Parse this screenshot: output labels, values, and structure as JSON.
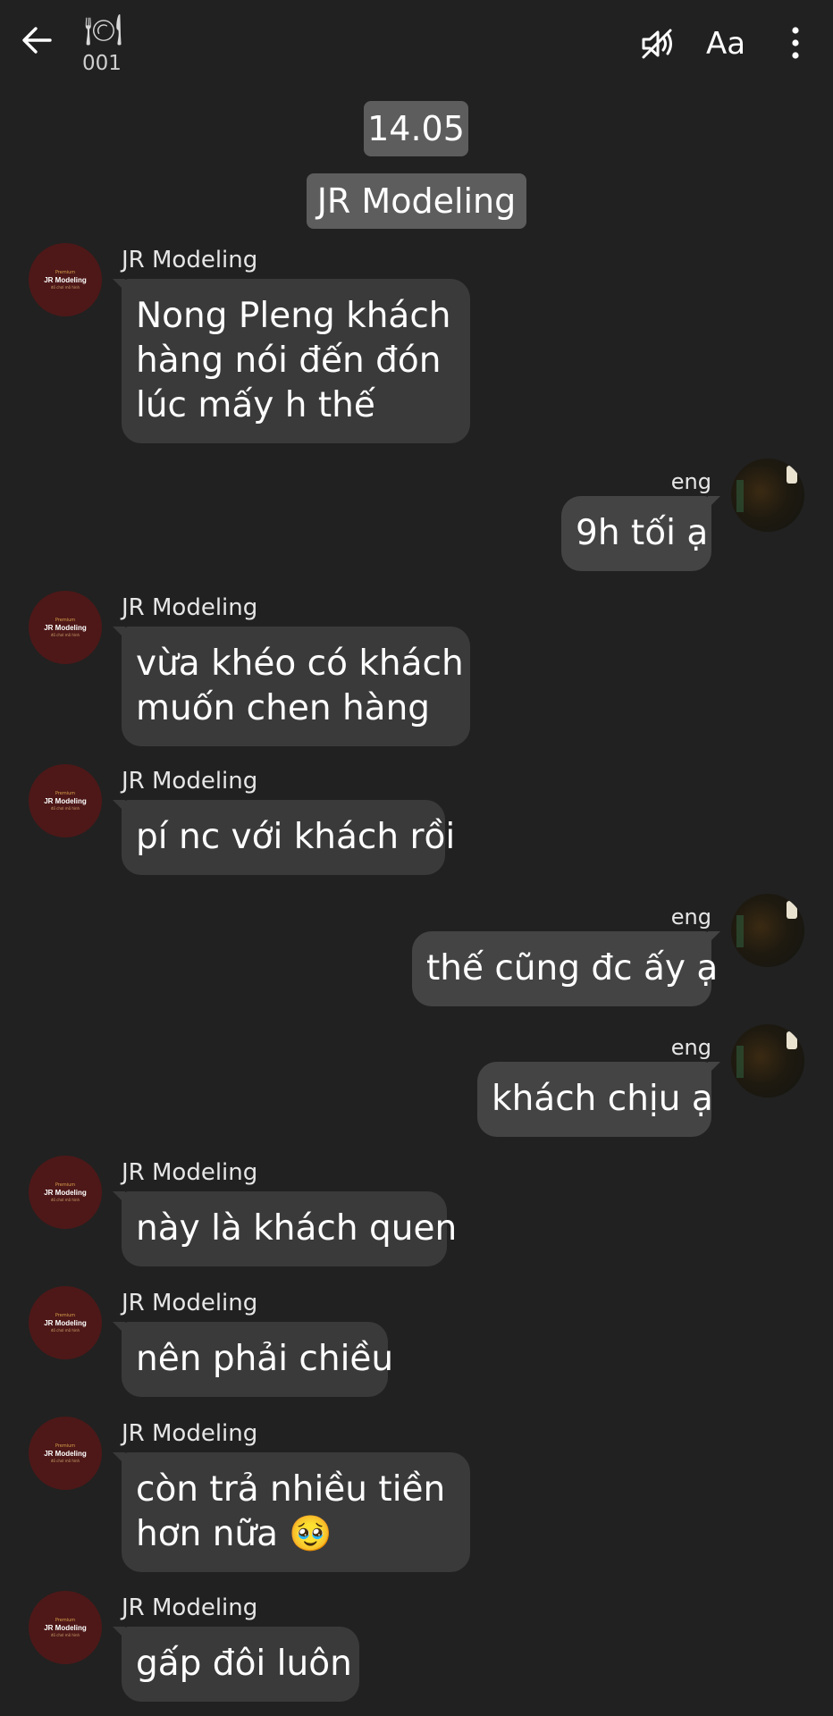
{
  "header": {
    "back_icon": "back-arrow-icon",
    "chat_icon": "fork-knife-icon",
    "room_number": "001",
    "mute_icon": "mute-icon",
    "font_label": "Aa",
    "more_icon": "more-vertical-icon"
  },
  "date_chip": "14.05",
  "name_chip": "JR Modeling",
  "avatar_jr": {
    "line1": "Premium",
    "line2": "JR Modeling",
    "line3": "đồ chơi mô hình"
  },
  "messages": [
    {
      "sender": "JR Modeling",
      "lines": [
        "Nong Pleng khách",
        "hàng nói đến đón",
        "lúc mấy h thế"
      ]
    },
    {
      "sender": "eng",
      "lines": [
        "9h tối ạ"
      ]
    },
    {
      "sender": "JR Modeling",
      "lines": [
        "vừa khéo có khách",
        "muốn chen hàng"
      ]
    },
    {
      "sender": "JR Modeling",
      "lines": [
        "pí nc với khách rồi"
      ]
    },
    {
      "sender": "eng",
      "lines": [
        "thế cũng đc ấy ạ"
      ]
    },
    {
      "sender": "eng",
      "lines": [
        "khách chịu ạ"
      ]
    },
    {
      "sender": "JR Modeling",
      "lines": [
        "này là khách quen"
      ]
    },
    {
      "sender": "JR Modeling",
      "lines": [
        "nên phải chiều"
      ]
    },
    {
      "sender": "JR Modeling",
      "lines": [
        "còn trả nhiều tiền",
        "hơn nữa 🥹"
      ]
    },
    {
      "sender": "JR Modeling",
      "lines": [
        "gấp đôi luôn"
      ]
    }
  ],
  "colors": {
    "background": "#212121",
    "bubble_in": "#3a3a3a",
    "bubble_out": "#444444",
    "chip": "#5d5d5d",
    "avatar": "#4e1818"
  }
}
